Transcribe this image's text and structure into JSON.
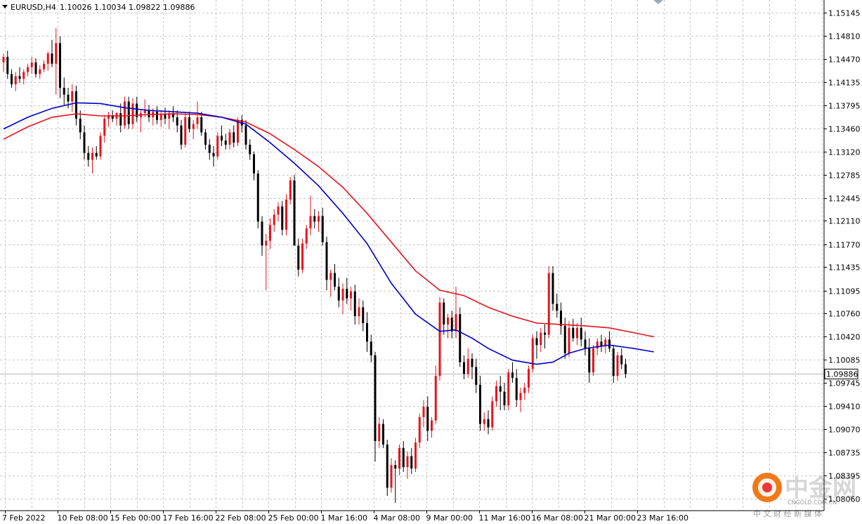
{
  "header": {
    "symbol": "EURUSD,H4",
    "ohlc": "1.10026 1.10034 1.09822 1.09886"
  },
  "current_price_label": "1.09886",
  "watermark": {
    "name": "中金网",
    "sub": "中 文 财 经 新 媒 体",
    "domain": "CNGOLD.COM.CN"
  },
  "colors": {
    "bull": "#e8141c",
    "bear": "#000000",
    "ma_fast": "#0000c8",
    "ma_slow": "#e8141c",
    "grid": "#c8c8c8",
    "axis": "#000000"
  },
  "chart_data": {
    "type": "candlestick",
    "instrument": "EURUSD",
    "timeframe": "H4",
    "ylim": [
      1.079,
      1.153
    ],
    "grid": true,
    "y_ticks": [
      "1.15145",
      "1.14810",
      "1.14470",
      "1.14135",
      "1.13795",
      "1.13460",
      "1.13120",
      "1.12785",
      "1.12445",
      "1.12110",
      "1.11770",
      "1.11435",
      "1.11095",
      "1.10760",
      "1.10420",
      "1.10085",
      "1.09745",
      "1.09410",
      "1.09070",
      "1.08735",
      "1.08395",
      "1.08060"
    ],
    "x_labels": [
      "7 Feb 2022",
      "10 Feb 08:00",
      "15 Feb 00:00",
      "17 Feb 16:00",
      "22 Feb 08:00",
      "25 Feb 00:00",
      "1 Mar 16:00",
      "4 Mar 08:00",
      "9 Mar 00:00",
      "11 Mar 16:00",
      "16 Mar 08:00",
      "21 Mar 00:00",
      "23 Mar 16:00"
    ],
    "current_price": 1.09886,
    "candles": [
      [
        1.1442,
        1.1455,
        1.1428,
        1.145
      ],
      [
        1.145,
        1.1459,
        1.1418,
        1.1425
      ],
      [
        1.1425,
        1.1432,
        1.1405,
        1.141
      ],
      [
        1.141,
        1.1428,
        1.14,
        1.1422
      ],
      [
        1.1422,
        1.1435,
        1.1412,
        1.1418
      ],
      [
        1.1418,
        1.1432,
        1.141,
        1.1428
      ],
      [
        1.1428,
        1.144,
        1.1422,
        1.1435
      ],
      [
        1.1435,
        1.145,
        1.1425,
        1.1442
      ],
      [
        1.1442,
        1.1448,
        1.142,
        1.1425
      ],
      [
        1.1425,
        1.1438,
        1.1418,
        1.1432
      ],
      [
        1.1432,
        1.1445,
        1.1428,
        1.144
      ],
      [
        1.144,
        1.1458,
        1.143,
        1.1455
      ],
      [
        1.1455,
        1.1475,
        1.1435,
        1.144
      ],
      [
        1.144,
        1.1492,
        1.1395,
        1.147
      ],
      [
        1.147,
        1.148,
        1.139,
        1.1405
      ],
      [
        1.1405,
        1.142,
        1.138,
        1.1395
      ],
      [
        1.1395,
        1.1405,
        1.1375,
        1.1385
      ],
      [
        1.1385,
        1.141,
        1.137,
        1.14
      ],
      [
        1.14,
        1.1408,
        1.135,
        1.136
      ],
      [
        1.136,
        1.1372,
        1.133,
        1.134
      ],
      [
        1.134,
        1.135,
        1.13,
        1.131
      ],
      [
        1.131,
        1.132,
        1.129,
        1.13
      ],
      [
        1.13,
        1.1318,
        1.128,
        1.131
      ],
      [
        1.131,
        1.132,
        1.13,
        1.1305
      ],
      [
        1.1305,
        1.134,
        1.13,
        1.1335
      ],
      [
        1.1335,
        1.1365,
        1.1325,
        1.136
      ],
      [
        1.136,
        1.137,
        1.1348,
        1.1365
      ],
      [
        1.1365,
        1.1372,
        1.1355,
        1.136
      ],
      [
        1.136,
        1.137,
        1.135,
        1.1368
      ],
      [
        1.1368,
        1.1382,
        1.134,
        1.135
      ],
      [
        1.135,
        1.1392,
        1.1345,
        1.1385
      ],
      [
        1.1385,
        1.1392,
        1.1345,
        1.1352
      ],
      [
        1.1352,
        1.139,
        1.1345,
        1.1382
      ],
      [
        1.1382,
        1.1392,
        1.1355,
        1.1362
      ],
      [
        1.1362,
        1.1372,
        1.134,
        1.1368
      ],
      [
        1.1368,
        1.1388,
        1.1362,
        1.1372
      ],
      [
        1.1372,
        1.138,
        1.1355,
        1.1362
      ],
      [
        1.1362,
        1.1375,
        1.135,
        1.137
      ],
      [
        1.137,
        1.1378,
        1.1352,
        1.1358
      ],
      [
        1.1358,
        1.1372,
        1.1348,
        1.1366
      ],
      [
        1.1366,
        1.1376,
        1.1352,
        1.136
      ],
      [
        1.136,
        1.1372,
        1.1345,
        1.1368
      ],
      [
        1.1368,
        1.1378,
        1.1355,
        1.1362
      ],
      [
        1.1362,
        1.1372,
        1.134,
        1.135
      ],
      [
        1.135,
        1.1358,
        1.1315,
        1.1322
      ],
      [
        1.1322,
        1.1368,
        1.1318,
        1.1362
      ],
      [
        1.1362,
        1.137,
        1.134,
        1.1345
      ],
      [
        1.1345,
        1.1358,
        1.133,
        1.1352
      ],
      [
        1.1352,
        1.1385,
        1.1345,
        1.1362
      ],
      [
        1.1362,
        1.137,
        1.1335,
        1.134
      ],
      [
        1.134,
        1.1345,
        1.1315,
        1.1322
      ],
      [
        1.1322,
        1.133,
        1.13,
        1.131
      ],
      [
        1.131,
        1.132,
        1.129,
        1.1305
      ],
      [
        1.1305,
        1.134,
        1.13,
        1.1335
      ],
      [
        1.1335,
        1.135,
        1.132,
        1.1328
      ],
      [
        1.1328,
        1.1338,
        1.1315,
        1.1322
      ],
      [
        1.1322,
        1.1345,
        1.1315,
        1.134
      ],
      [
        1.134,
        1.135,
        1.1318,
        1.1325
      ],
      [
        1.1325,
        1.1362,
        1.132,
        1.1358
      ],
      [
        1.1358,
        1.1365,
        1.134,
        1.135
      ],
      [
        1.135,
        1.1358,
        1.1315,
        1.1322
      ],
      [
        1.1322,
        1.133,
        1.13,
        1.1308
      ],
      [
        1.1308,
        1.1312,
        1.127,
        1.128
      ],
      [
        1.128,
        1.1285,
        1.12,
        1.121
      ],
      [
        1.121,
        1.1218,
        1.116,
        1.1175
      ],
      [
        1.1175,
        1.1192,
        1.111,
        1.1182
      ],
      [
        1.1182,
        1.1215,
        1.117,
        1.1205
      ],
      [
        1.1205,
        1.1228,
        1.1195,
        1.122
      ],
      [
        1.122,
        1.1238,
        1.121,
        1.1232
      ],
      [
        1.1232,
        1.124,
        1.119,
        1.1198
      ],
      [
        1.1198,
        1.125,
        1.119,
        1.1242
      ],
      [
        1.1242,
        1.1275,
        1.1235,
        1.127
      ],
      [
        1.127,
        1.1278,
        1.12,
        1.1175
      ],
      [
        1.1175,
        1.1185,
        1.113,
        1.114
      ],
      [
        1.114,
        1.1185,
        1.1135,
        1.1178
      ],
      [
        1.1178,
        1.1205,
        1.117,
        1.12
      ],
      [
        1.12,
        1.1248,
        1.119,
        1.1218
      ],
      [
        1.1218,
        1.1228,
        1.12,
        1.121
      ],
      [
        1.121,
        1.1225,
        1.1195,
        1.1218
      ],
      [
        1.1218,
        1.123,
        1.1175,
        1.118
      ],
      [
        1.118,
        1.1188,
        1.111,
        1.1125
      ],
      [
        1.1125,
        1.114,
        1.11,
        1.1135
      ],
      [
        1.1135,
        1.1148,
        1.111,
        1.1115
      ],
      [
        1.1115,
        1.1128,
        1.1085,
        1.1095
      ],
      [
        1.1095,
        1.112,
        1.1075,
        1.1112
      ],
      [
        1.1112,
        1.1128,
        1.109,
        1.1098
      ],
      [
        1.1098,
        1.1115,
        1.108,
        1.1108
      ],
      [
        1.1108,
        1.1118,
        1.106,
        1.1072
      ],
      [
        1.1072,
        1.1098,
        1.106,
        1.1085
      ],
      [
        1.1085,
        1.1095,
        1.105,
        1.1062
      ],
      [
        1.1062,
        1.1078,
        1.102,
        1.1035
      ],
      [
        1.1035,
        1.1045,
        1.1005,
        1.1015
      ],
      [
        1.1015,
        1.102,
        1.086,
        1.089
      ],
      [
        1.089,
        1.0925,
        1.088,
        1.0915
      ],
      [
        1.0915,
        1.0922,
        1.088,
        1.0885
      ],
      [
        1.0885,
        1.0892,
        1.081,
        1.0822
      ],
      [
        1.0822,
        1.0865,
        1.0815,
        1.0855
      ],
      [
        1.0855,
        1.0862,
        1.08,
        1.085
      ],
      [
        1.085,
        1.0885,
        1.084,
        1.088
      ],
      [
        1.088,
        1.089,
        1.0845,
        1.0852
      ],
      [
        1.0852,
        1.0875,
        1.0835,
        1.0868
      ],
      [
        1.0868,
        1.088,
        1.0842,
        1.085
      ],
      [
        1.085,
        1.0895,
        1.0845,
        1.0888
      ],
      [
        1.0888,
        1.093,
        1.088,
        1.0925
      ],
      [
        1.0925,
        1.095,
        1.091,
        1.094
      ],
      [
        1.094,
        1.0955,
        1.089,
        1.0905
      ],
      [
        1.0905,
        1.0925,
        1.0895,
        1.092
      ],
      [
        1.092,
        1.1,
        1.0915,
        1.0985
      ],
      [
        1.0985,
        1.11,
        1.0978,
        1.1092
      ],
      [
        1.1092,
        1.1098,
        1.1045,
        1.106
      ],
      [
        1.106,
        1.1075,
        1.104,
        1.107
      ],
      [
        1.107,
        1.108,
        1.104,
        1.105
      ],
      [
        1.105,
        1.1115,
        1.104,
        1.1075
      ],
      [
        1.1075,
        1.1085,
        1.0998,
        1.1005
      ],
      [
        1.1005,
        1.1015,
        1.098,
        1.0988
      ],
      [
        1.0988,
        1.1025,
        1.0982,
        1.101
      ],
      [
        1.101,
        1.1018,
        1.098,
        1.0998
      ],
      [
        1.0998,
        1.101,
        1.096,
        1.0972
      ],
      [
        1.0972,
        1.0985,
        1.0905,
        1.0915
      ],
      [
        1.0915,
        1.0932,
        1.0905,
        1.0922
      ],
      [
        1.0922,
        1.0935,
        1.09,
        1.091
      ],
      [
        1.091,
        1.0955,
        1.0905,
        1.0948
      ],
      [
        1.0948,
        1.0978,
        1.094,
        1.097
      ],
      [
        1.097,
        1.0985,
        1.0935,
        1.0962
      ],
      [
        1.0962,
        1.0975,
        1.0935,
        1.0942
      ],
      [
        1.0942,
        1.0995,
        1.0935,
        1.099
      ],
      [
        1.099,
        1.1005,
        1.0975,
        1.0982
      ],
      [
        1.0982,
        1.0995,
        1.094,
        1.095
      ],
      [
        1.095,
        1.0968,
        1.0932,
        1.096
      ],
      [
        1.096,
        1.0975,
        1.095,
        1.0968
      ],
      [
        1.0968,
        1.1,
        1.096,
        1.0995
      ],
      [
        1.0995,
        1.1045,
        1.099,
        1.104
      ],
      [
        1.104,
        1.105,
        1.101,
        1.103
      ],
      [
        1.103,
        1.1055,
        1.102,
        1.1048
      ],
      [
        1.1048,
        1.106,
        1.1025,
        1.1045
      ],
      [
        1.1045,
        1.1145,
        1.104,
        1.1135
      ],
      [
        1.1135,
        1.1145,
        1.108,
        1.109
      ],
      [
        1.109,
        1.1105,
        1.107,
        1.108
      ],
      [
        1.108,
        1.1092,
        1.1045,
        1.1058
      ],
      [
        1.1058,
        1.107,
        1.101,
        1.1018
      ],
      [
        1.1018,
        1.1065,
        1.1012,
        1.1055
      ],
      [
        1.1055,
        1.1068,
        1.1035,
        1.104
      ],
      [
        1.104,
        1.1062,
        1.103,
        1.1055
      ],
      [
        1.1055,
        1.107,
        1.1028,
        1.1038
      ],
      [
        1.1038,
        1.105,
        1.1015,
        1.1025
      ],
      [
        1.1025,
        1.104,
        1.0975,
        1.099
      ],
      [
        1.099,
        1.103,
        1.0985,
        1.1025
      ],
      [
        1.1025,
        1.104,
        1.1015,
        1.1035
      ],
      [
        1.1035,
        1.1045,
        1.102,
        1.1028
      ],
      [
        1.1028,
        1.1042,
        1.1018,
        1.1038
      ],
      [
        1.1038,
        1.105,
        1.102,
        1.1025
      ],
      [
        1.1025,
        1.103,
        1.0975,
        1.0985
      ],
      [
        1.0985,
        1.102,
        1.0978,
        1.1015
      ],
      [
        1.1015,
        1.1025,
        1.0995,
        1.1002
      ],
      [
        1.1002,
        1.101,
        1.0982,
        1.0988
      ]
    ],
    "ma_fast": [
      [
        0,
        1.1345
      ],
      [
        6,
        1.1362
      ],
      [
        12,
        1.1375
      ],
      [
        18,
        1.1383
      ],
      [
        24,
        1.1382
      ],
      [
        30,
        1.1376
      ],
      [
        36,
        1.1372
      ],
      [
        42,
        1.137
      ],
      [
        48,
        1.1368
      ],
      [
        54,
        1.1362
      ],
      [
        60,
        1.1352
      ],
      [
        66,
        1.1325
      ],
      [
        72,
        1.1295
      ],
      [
        78,
        1.1262
      ],
      [
        84,
        1.1222
      ],
      [
        90,
        1.1178
      ],
      [
        96,
        1.112
      ],
      [
        102,
        1.1075
      ],
      [
        108,
        1.105
      ],
      [
        112,
        1.1052
      ],
      [
        116,
        1.104
      ],
      [
        120,
        1.1025
      ],
      [
        126,
        1.1008
      ],
      [
        132,
        1.1002
      ],
      [
        136,
        1.1005
      ],
      [
        140,
        1.1018
      ],
      [
        144,
        1.1025
      ],
      [
        150,
        1.103
      ],
      [
        156,
        1.1025
      ],
      [
        161,
        1.102
      ]
    ],
    "ma_slow": [
      [
        0,
        1.133
      ],
      [
        6,
        1.1348
      ],
      [
        12,
        1.1362
      ],
      [
        18,
        1.1367
      ],
      [
        24,
        1.1364
      ],
      [
        30,
        1.1364
      ],
      [
        36,
        1.1366
      ],
      [
        42,
        1.1367
      ],
      [
        48,
        1.1366
      ],
      [
        54,
        1.1362
      ],
      [
        60,
        1.1355
      ],
      [
        66,
        1.1338
      ],
      [
        72,
        1.1315
      ],
      [
        78,
        1.129
      ],
      [
        84,
        1.126
      ],
      [
        90,
        1.1222
      ],
      [
        96,
        1.118
      ],
      [
        102,
        1.1138
      ],
      [
        108,
        1.111
      ],
      [
        114,
        1.1102
      ],
      [
        120,
        1.1085
      ],
      [
        126,
        1.1072
      ],
      [
        132,
        1.1062
      ],
      [
        138,
        1.106
      ],
      [
        144,
        1.1058
      ],
      [
        150,
        1.1055
      ],
      [
        156,
        1.1048
      ],
      [
        161,
        1.1042
      ]
    ]
  }
}
